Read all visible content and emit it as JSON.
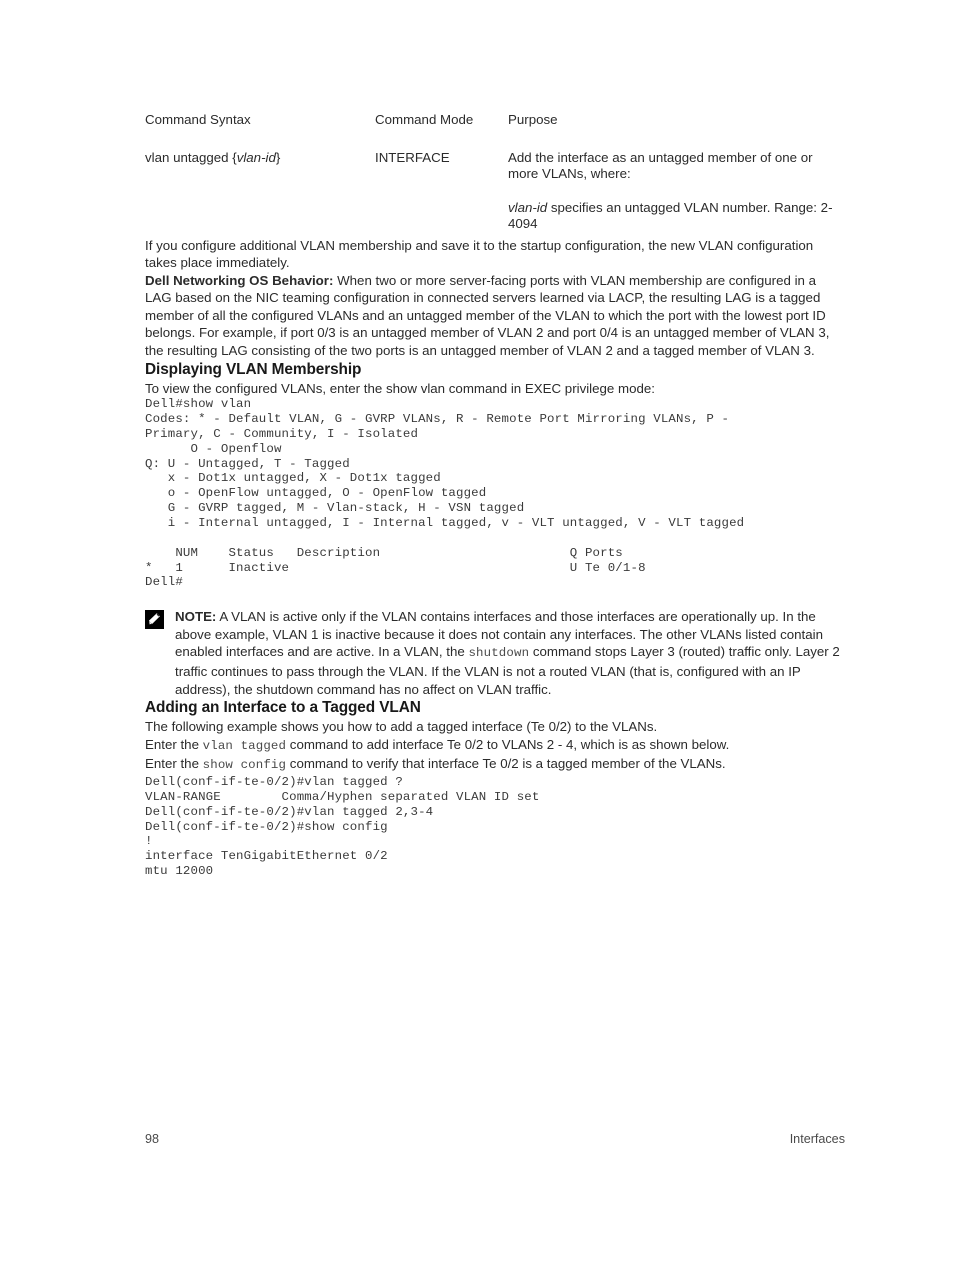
{
  "syntax_table": {
    "headers": [
      "Command Syntax",
      "Command Mode",
      "Purpose"
    ],
    "row": {
      "syntax_pre": "vlan untagged {",
      "syntax_em": "vlan-id",
      "syntax_post": "}",
      "mode": "INTERFACE",
      "purpose_main": "Add the interface as an untagged member of one or more VLANs, where:",
      "purpose_extra_em": "vlan-id",
      "purpose_extra_rest": " specifies an untagged VLAN number. Range: 2-4094"
    }
  },
  "intro_paragraph": "If you configure additional VLAN membership and save it to the startup configuration, the new VLAN configuration takes place immediately.",
  "behavior": {
    "label": "Dell Networking OS Behavior:",
    "text": " When two or more server-facing ports with VLAN membership are configured in a LAG based on the NIC teaming configuration in connected servers learned via LACP, the resulting LAG is a tagged member of all the configured VLANs and an untagged member of the VLAN to which the port with the lowest port ID belongs. For example, if port 0/3 is an untagged member of VLAN 2 and port 0/4 is an untagged member of VLAN 3, the resulting LAG consisting of the two ports is an untagged member of VLAN 2 and a tagged member of VLAN 3."
  },
  "section_display": {
    "heading": "Displaying VLAN Membership",
    "lead": "To view the configured VLANs, enter the show vlan command in EXEC privilege mode:",
    "command_line": "Dell#show vlan",
    "output": "Codes: * - Default VLAN, G - GVRP VLANs, R - Remote Port Mirroring VLANs, P -\nPrimary, C - Community, I - Isolated\n      O - Openflow\nQ: U - Untagged, T - Tagged\n   x - Dot1x untagged, X - Dot1x tagged\n   o - OpenFlow untagged, O - OpenFlow tagged\n   G - GVRP tagged, M - Vlan-stack, H - VSN tagged\n   i - Internal untagged, I - Internal tagged, v - VLT untagged, V - VLT tagged\n\n    NUM    Status   Description                         Q Ports\n*   1      Inactive                                     U Te 0/1-8\nDell#"
  },
  "note": {
    "icon": "note-pencil-icon",
    "label": "NOTE:",
    "text_1": " A VLAN is active only if the VLAN contains interfaces and those interfaces are operationally up. In the above example, VLAN 1 is inactive because it does not contain any interfaces. The other VLANs listed contain enabled interfaces and are active. In a VLAN, the ",
    "inline_code": "shutdown",
    "text_2": " command stops Layer 3 (routed) traffic only. Layer 2 traffic continues to pass through the VLAN. If the VLAN is not a routed VLAN (that is, configured with an IP address), the shutdown command has no affect on VLAN traffic."
  },
  "section_tagged": {
    "heading": "Adding an Interface to a Tagged VLAN",
    "para_1": "The following example shows you how to add a tagged interface (Te 0/2) to the VLANs.",
    "para_2_pre": "Enter the ",
    "para_2_code": "vlan tagged",
    "para_2_post": " command to add interface Te 0/2 to VLANs 2 - 4, which is as shown below.",
    "para_3_pre": "Enter the ",
    "para_3_code": "show config",
    "para_3_post": " command to verify that interface Te 0/2 is a tagged member of the VLANs.",
    "output": "Dell(conf-if-te-0/2)#vlan tagged ?\nVLAN-RANGE        Comma/Hyphen separated VLAN ID set\nDell(conf-if-te-0/2)#vlan tagged 2,3-4\nDell(conf-if-te-0/2)#show config\n!\ninterface TenGigabitEthernet 0/2\nmtu 12000"
  },
  "footer": {
    "page_number": "98",
    "section_name": "Interfaces"
  },
  "colors": {
    "body_text": "#2b2b2b",
    "heading_text": "#191919",
    "code_text": "#3a3a3a",
    "footer_text": "#4a4a4a",
    "note_icon_bg": "#000000",
    "page_bg": "#ffffff"
  }
}
